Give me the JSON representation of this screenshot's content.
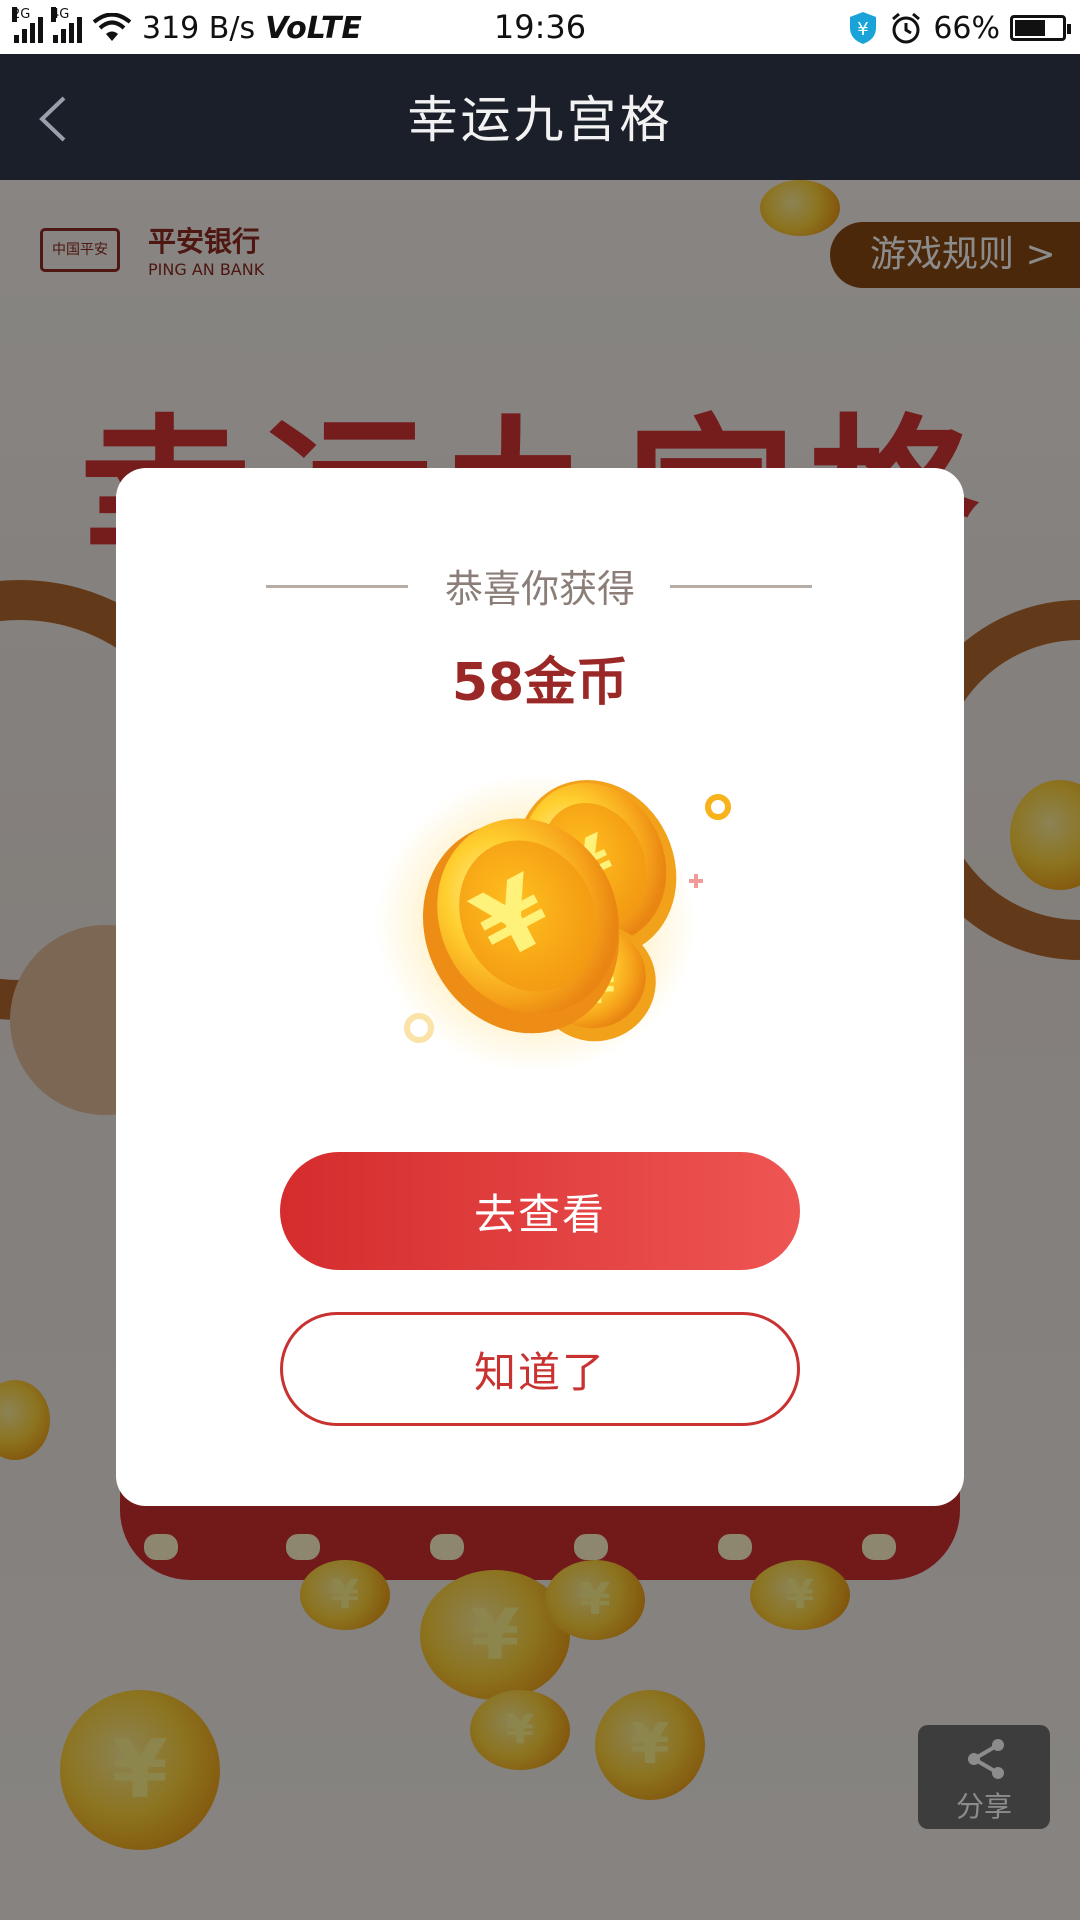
{
  "status_bar": {
    "network_2g": "2G",
    "network_4g": "4G",
    "speed": "319 B/s",
    "volte": "VoLTE",
    "time": "19:36",
    "battery": "66%",
    "battery_level": 0.66,
    "icons": [
      "signal-icon",
      "wifi-icon",
      "shield-yen-icon",
      "alarm-icon",
      "battery-icon"
    ]
  },
  "header": {
    "title": "幸运九宫格",
    "back_icon": "chevron-left-icon"
  },
  "page": {
    "brand_badge": "中国平安",
    "brand_name": "平安银行",
    "brand_sub": "PING AN BANK",
    "rules_button": "游戏规则 >",
    "big_title": "幸运九宫格",
    "share_label": "分享"
  },
  "modal": {
    "title": "恭喜你获得",
    "reward": "58金币",
    "primary_button": "去查看",
    "secondary_button": "知道了"
  },
  "colors": {
    "header_bg": "#1b1f2a",
    "accent_red": "#d52c2e",
    "reward_text": "#9a2826",
    "coin_gold": "#ffd33a"
  }
}
